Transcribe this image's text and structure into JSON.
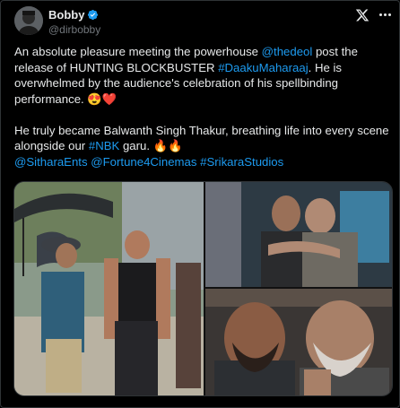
{
  "author": {
    "display_name": "Bobby",
    "handle": "@dirbobby",
    "verified": true,
    "verified_color": "#1d9bf0"
  },
  "icons": {
    "brand": "x-logo-icon",
    "menu": "more-icon",
    "verified": "verified-badge-icon"
  },
  "tweet": {
    "line1_a": "An absolute pleasure meeting the powerhouse ",
    "line1_mention": "@thedeol",
    "line1_b": " post the release of HUNTING BLOCKBUSTER ",
    "line1_hashtag": "#DaakuMaharaaj",
    "line1_c": ". He is overwhelmed by the audience's celebration of his spellbinding performance. 😍❤️",
    "line2_a": "He truly became Balwanth Singh Thakur, breathing life into every scene alongside our ",
    "line2_hashtag": "#NBK",
    "line2_b": " garu. 🔥🔥",
    "tag_1": "@SitharaEnts",
    "tag_2": "@Fortune4Cinemas",
    "tag_3": "#SrikaraStudios"
  },
  "media": {
    "count": 3
  },
  "colors": {
    "background": "#000000",
    "text": "#e7e9ea",
    "secondary": "#71767b",
    "link": "#1d9bf0",
    "border": "#2f3336"
  }
}
